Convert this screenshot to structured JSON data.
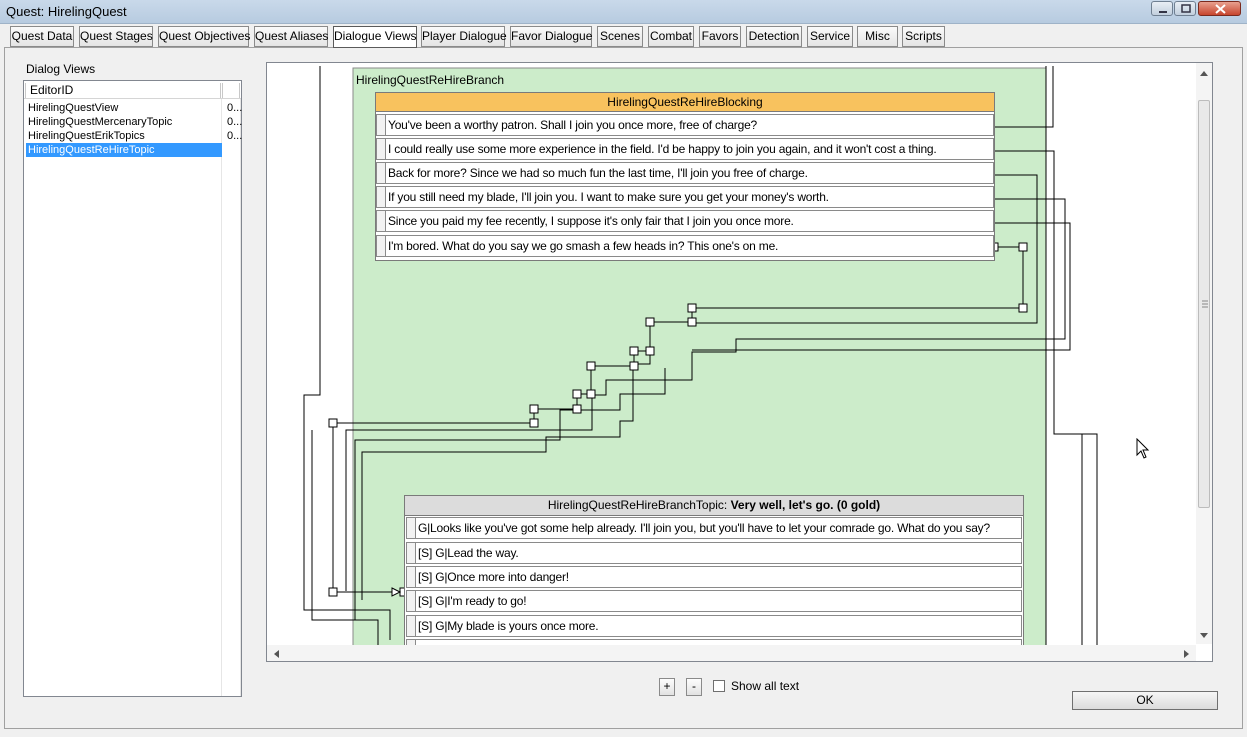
{
  "window": {
    "title": "Quest: HirelingQuest"
  },
  "tabs": [
    {
      "label": "Quest Data"
    },
    {
      "label": "Quest Stages"
    },
    {
      "label": "Quest Objectives"
    },
    {
      "label": "Quest Aliases"
    },
    {
      "label": "Dialogue Views",
      "active": true
    },
    {
      "label": "Player Dialogue"
    },
    {
      "label": "Favor Dialogue"
    },
    {
      "label": "Scenes"
    },
    {
      "label": "Combat"
    },
    {
      "label": "Favors"
    },
    {
      "label": "Detection"
    },
    {
      "label": "Service"
    },
    {
      "label": "Misc"
    },
    {
      "label": "Scripts"
    }
  ],
  "dialog_views": {
    "label": "Dialog Views",
    "column_header": "EditorID",
    "items": [
      {
        "id": "HirelingQuestView",
        "extra": "0..."
      },
      {
        "id": "HirelingQuestMercenaryTopic",
        "extra": "0..."
      },
      {
        "id": "HirelingQuestErikTopics",
        "extra": "0..."
      },
      {
        "id": "HirelingQuestReHireTopic",
        "extra": "",
        "selected": true
      }
    ]
  },
  "graph": {
    "branch_label": "HirelingQuestReHireBranch",
    "blocking_node": {
      "title": "HirelingQuestReHireBlocking",
      "responses": [
        "You've been a worthy patron. Shall I join you once more, free of charge?",
        "I could really use some more experience in the field. I'd be happy to join you again, and it won't cost a thing.",
        "Back for more? Since we had so much fun the last time, I'll join you free of charge.",
        "If you still need my blade, I'll join you. I want to make sure you get your money's worth.",
        "Since you paid my fee recently, I suppose it's only fair that I join you once more.",
        "I'm bored. What do you say we go smash a few heads in? This one's on me."
      ]
    },
    "topic_node": {
      "title_prefix": "HirelingQuestReHireBranchTopic:",
      "title_bold": "Very well, let's go. (0 gold)",
      "responses": [
        "G|Looks like you've got some help already. I'll join you, but you'll have to let your comrade go. What do you say?",
        "[S] G|Lead the way.",
        "[S] G|Once more into danger!",
        "[S] G|I'm ready to go!",
        "[S] G|My blade is yours once more."
      ]
    },
    "colors": {
      "branch_bg": "#ccecca",
      "blocking_header": "#f8c25e",
      "topic_header": "#dcdcdc"
    }
  },
  "controls": {
    "zoom_in": "+",
    "zoom_out": "-",
    "show_all_text_label": "Show all text",
    "show_all_text_checked": false,
    "ok_label": "OK"
  }
}
